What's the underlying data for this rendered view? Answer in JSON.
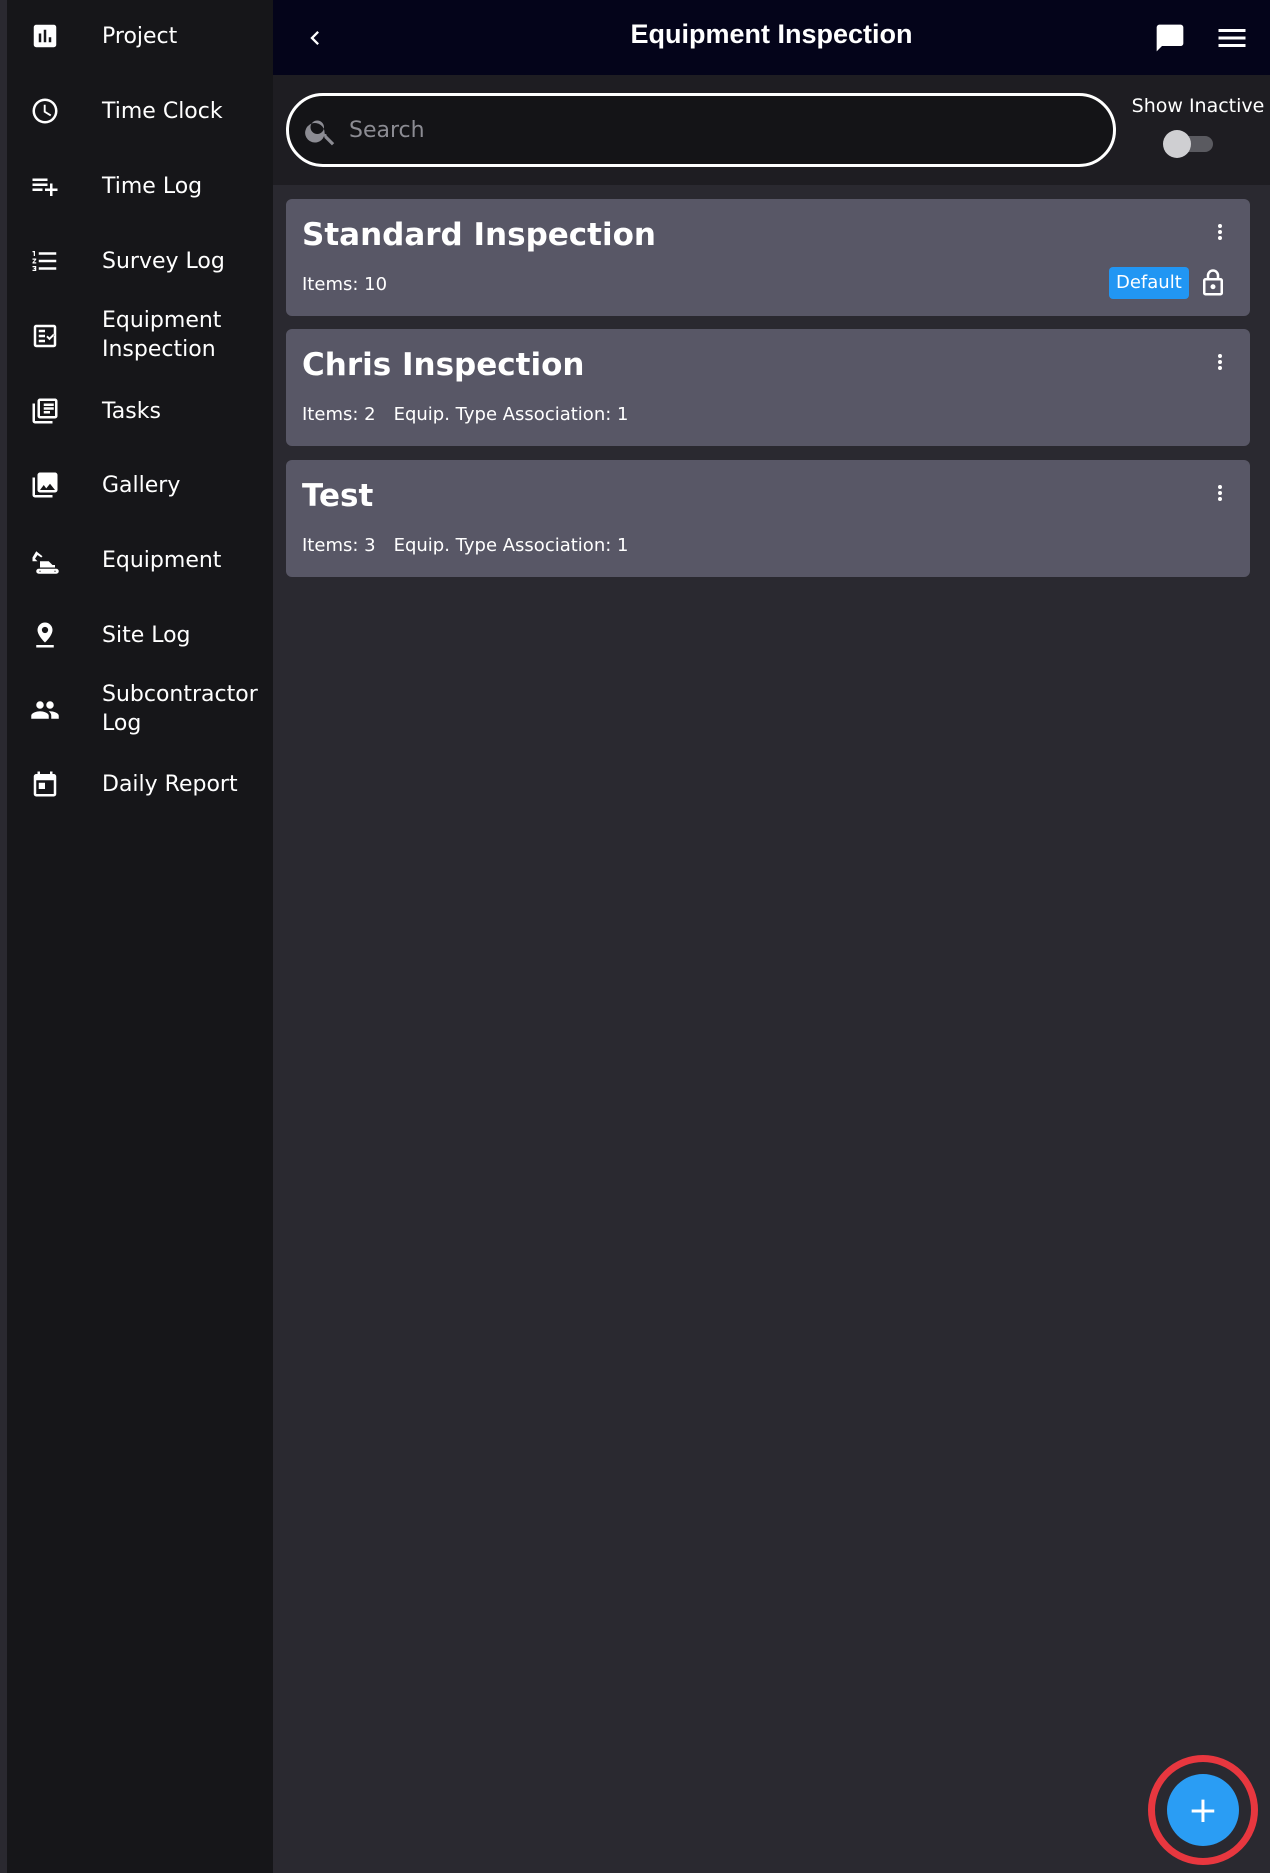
{
  "sidebar": {
    "items": [
      {
        "label": "Project",
        "icon": "bar-chart-icon"
      },
      {
        "label": "Time Clock",
        "icon": "clock-icon"
      },
      {
        "label": "Time Log",
        "icon": "playlist-add-icon"
      },
      {
        "label": "Survey Log",
        "icon": "list-icon"
      },
      {
        "label": "Equipment Inspection",
        "icon": "checklist-icon"
      },
      {
        "label": "Tasks",
        "icon": "library-icon"
      },
      {
        "label": "Gallery",
        "icon": "image-icon"
      },
      {
        "label": "Equipment",
        "icon": "excavator-icon"
      },
      {
        "label": "Site Log",
        "icon": "location-pin-icon"
      },
      {
        "label": "Subcontractor Log",
        "icon": "people-icon"
      },
      {
        "label": "Daily Report",
        "icon": "calendar-icon"
      }
    ]
  },
  "header": {
    "title": "Equipment Inspection"
  },
  "search": {
    "placeholder": "Search",
    "value": "",
    "show_inactive_label": "Show Inactive",
    "show_inactive": false
  },
  "cards": [
    {
      "title": "Standard Inspection",
      "items": "Items: 10",
      "assoc": "",
      "badge": "Default",
      "locked": true
    },
    {
      "title": "Chris Inspection",
      "items": "Items: 2",
      "assoc": "Equip. Type Association: 1"
    },
    {
      "title": "Test",
      "items": "Items: 3",
      "assoc": "Equip. Type Association: 1"
    }
  ],
  "fab": {
    "label": "+"
  },
  "colors": {
    "accent": "#2196f3",
    "fab_ring": "#e8373f",
    "card_bg": "#585766",
    "header_bg": "#04041a"
  }
}
